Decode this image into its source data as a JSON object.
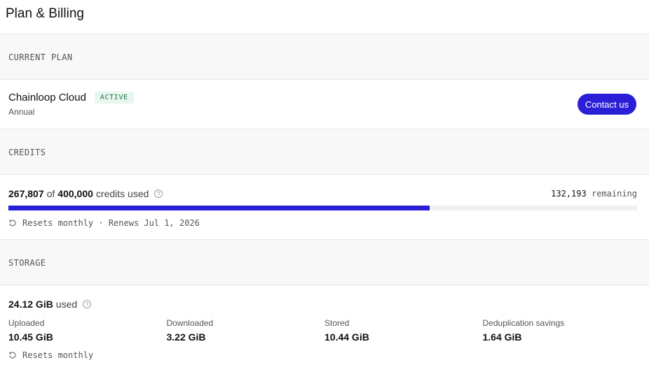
{
  "page": {
    "title": "Plan & Billing"
  },
  "sections": {
    "current_plan": "CURRENT PLAN",
    "credits": "CREDITS",
    "storage": "STORAGE"
  },
  "plan": {
    "name": "Chainloop Cloud",
    "status": "ACTIVE",
    "cycle": "Annual",
    "contact_label": "Contact us"
  },
  "credits": {
    "used": "267,807",
    "of_text": "of",
    "total": "400,000",
    "suffix": "credits used",
    "remaining_value": "132,193",
    "remaining_label": "remaining",
    "fraction_used": 0.6695,
    "reset_text": "Resets monthly · Renews Jul 1, 2026"
  },
  "storage": {
    "used": "24.12 GiB",
    "used_suffix": "used",
    "stats": [
      {
        "label": "Uploaded",
        "value": "10.45 GiB"
      },
      {
        "label": "Downloaded",
        "value": "3.22 GiB"
      },
      {
        "label": "Stored",
        "value": "10.44 GiB"
      },
      {
        "label": "Deduplication savings",
        "value": "1.64 GiB"
      }
    ],
    "reset_text": "Resets monthly"
  },
  "colors": {
    "accent": "#2a1fd6",
    "badge_bg": "#e7f6ee",
    "badge_text": "#1f7a4a",
    "section_bg": "#f8f8f8"
  }
}
